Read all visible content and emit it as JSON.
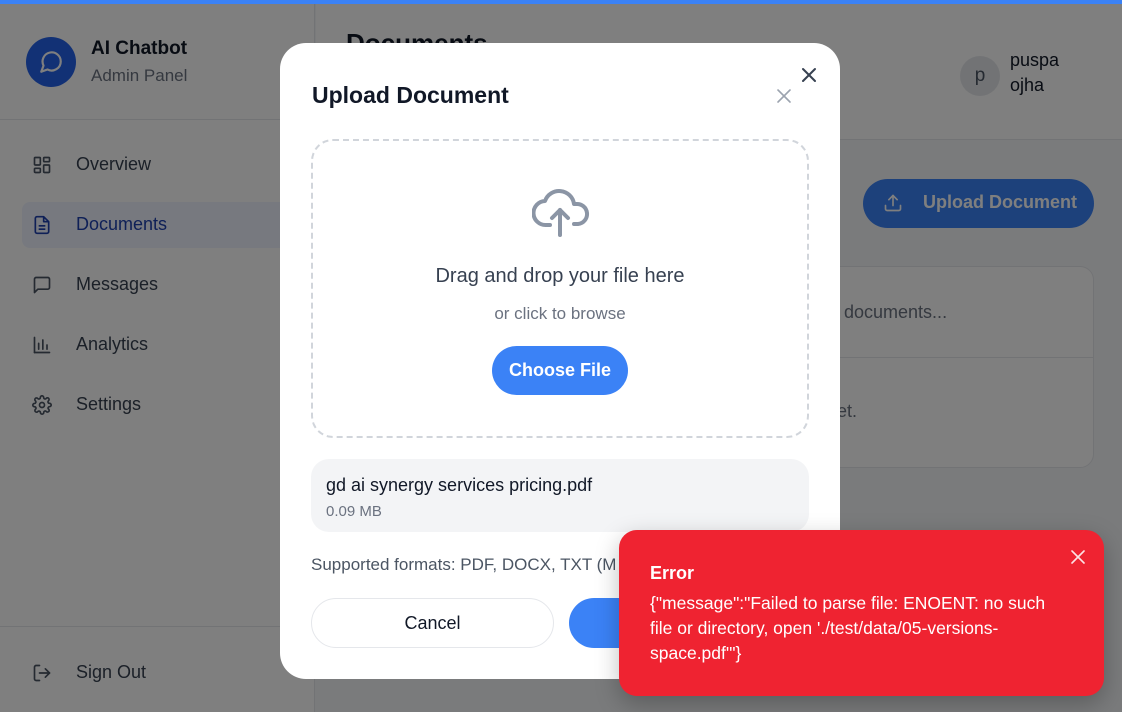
{
  "colors": {
    "accent": "#3b82f6",
    "error": "#ef2331",
    "overlay": "rgba(0,0,0,0.5)"
  },
  "brand": {
    "title": "AI Chatbot",
    "subtitle": "Admin Panel",
    "icon": "chat-bubble-icon"
  },
  "sidebar": {
    "items": [
      {
        "label": "Overview",
        "icon": "grid-icon",
        "active": false
      },
      {
        "label": "Documents",
        "icon": "document-icon",
        "active": true
      },
      {
        "label": "Messages",
        "icon": "message-icon",
        "active": false
      },
      {
        "label": "Analytics",
        "icon": "bar-chart-icon",
        "active": false
      },
      {
        "label": "Settings",
        "icon": "gear-icon",
        "active": false
      }
    ],
    "sign_out": "Sign Out"
  },
  "header": {
    "title": "Documents",
    "user": {
      "initial": "p",
      "name": "puspa ojha"
    }
  },
  "main": {
    "upload_button": "Upload Document",
    "search_placeholder": "h documents...",
    "empty_text": "et."
  },
  "modal": {
    "title": "Upload Document",
    "dropzone": {
      "title": "Drag and drop your file here",
      "subtitle": "or click to browse",
      "button": "Choose File"
    },
    "file": {
      "name": "gd ai synergy services pricing.pdf",
      "size": "0.09 MB"
    },
    "formats": "Supported formats: PDF, DOCX, TXT (M",
    "cancel": "Cancel",
    "submit": ""
  },
  "toast": {
    "title": "Error",
    "message": "{\"message\":\"Failed to parse file: ENOENT: no such file or directory, open './test/data/05-versions-space.pdf'\"}"
  }
}
